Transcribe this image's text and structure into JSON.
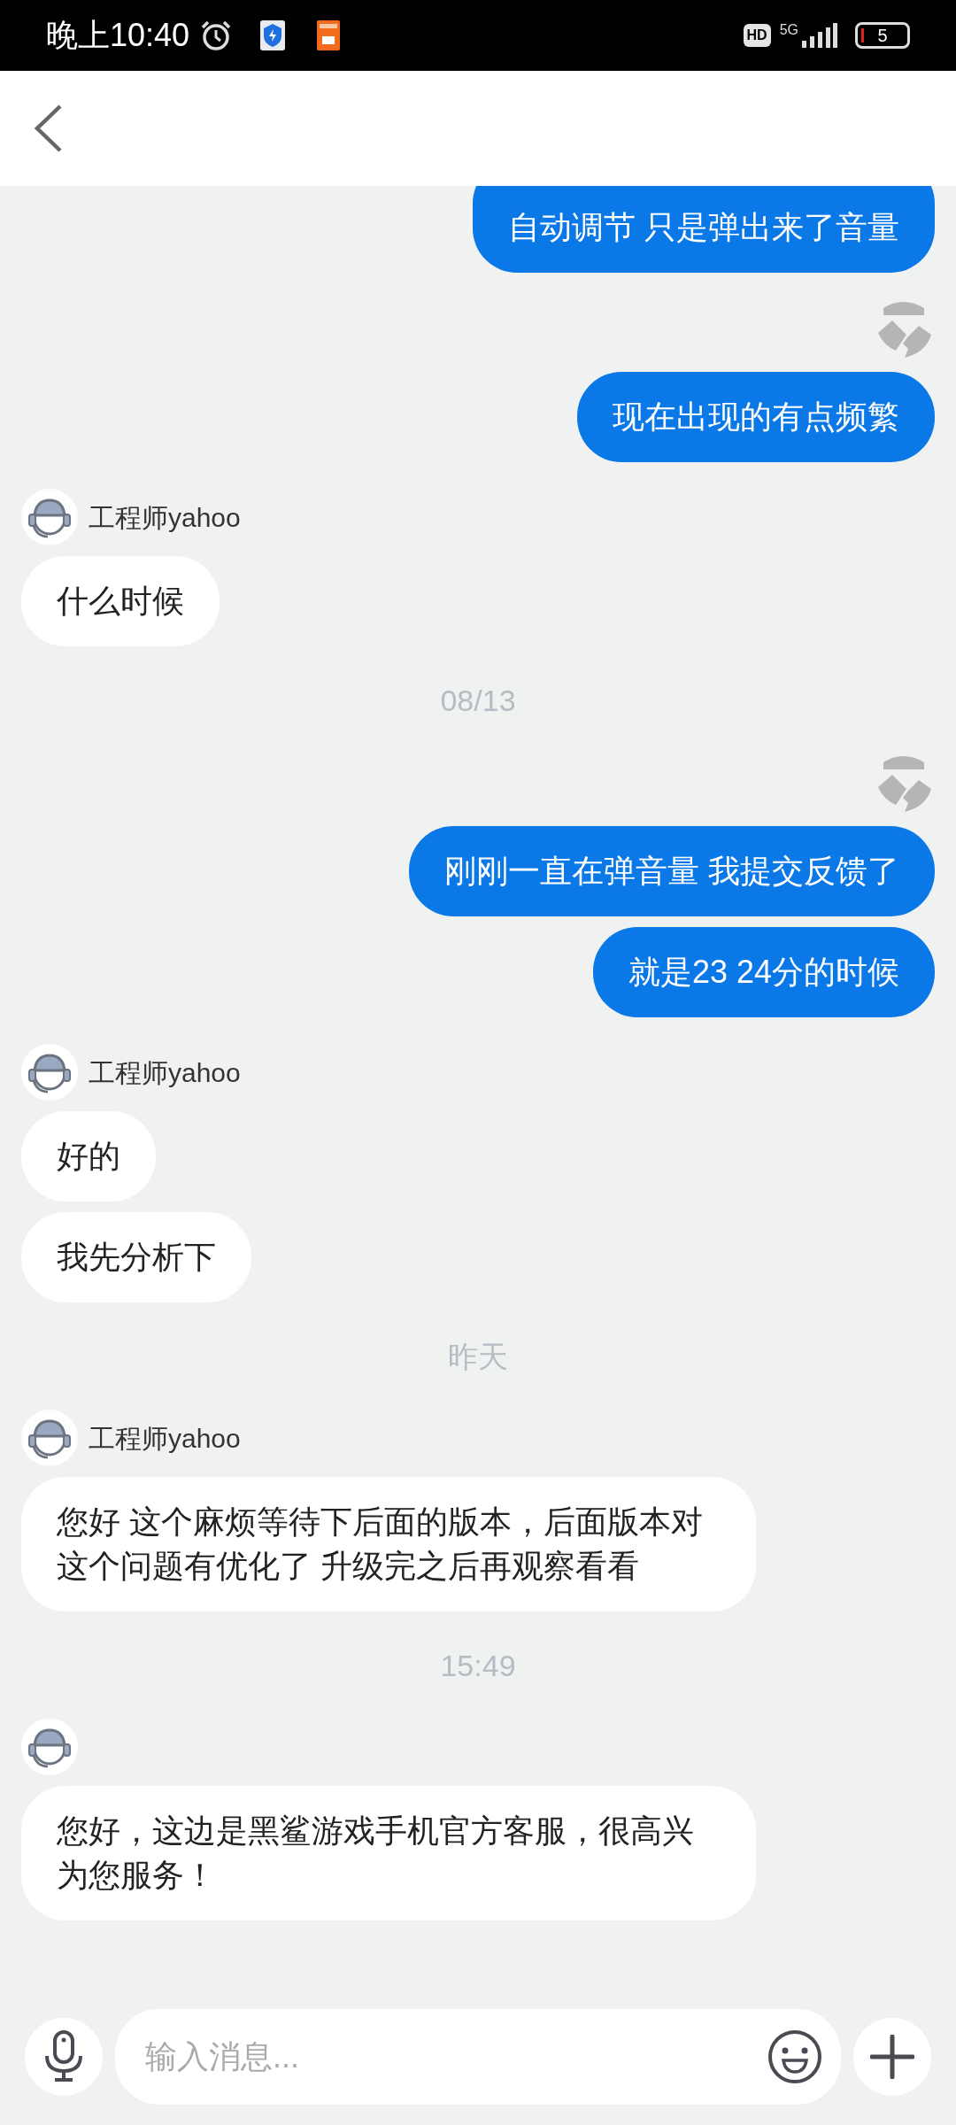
{
  "status_bar": {
    "time": "晚上10:40",
    "hd": "HD",
    "network": "5G",
    "battery": "5"
  },
  "messages": [
    {
      "kind": "outgoing",
      "avatar": false,
      "bubbles": [
        "自动调节 只是弹出来了音量"
      ]
    },
    {
      "kind": "outgoing",
      "avatar": true,
      "bubbles": [
        "现在出现的有点频繁"
      ]
    },
    {
      "kind": "incoming",
      "sender": "工程师yahoo",
      "bubbles": [
        "什么时候"
      ]
    },
    {
      "kind": "timestamp",
      "text": "08/13"
    },
    {
      "kind": "outgoing",
      "avatar": true,
      "bubbles": [
        "刚刚一直在弹音量 我提交反馈了",
        "就是23 24分的时候"
      ]
    },
    {
      "kind": "incoming",
      "sender": "工程师yahoo",
      "bubbles": [
        "好的",
        "我先分析下"
      ]
    },
    {
      "kind": "timestamp",
      "text": "昨天"
    },
    {
      "kind": "incoming",
      "sender": "工程师yahoo",
      "bubbles": [
        "您好 这个麻烦等待下后面的版本，后面版本对这个问题有优化了 升级完之后再观察看看"
      ]
    },
    {
      "kind": "timestamp",
      "text": "15:49"
    },
    {
      "kind": "incoming",
      "bubbles": [
        "您好，这边是黑鲨游戏手机官方客服，很高兴为您服务！"
      ]
    }
  ],
  "composer": {
    "placeholder": "输入消息..."
  }
}
